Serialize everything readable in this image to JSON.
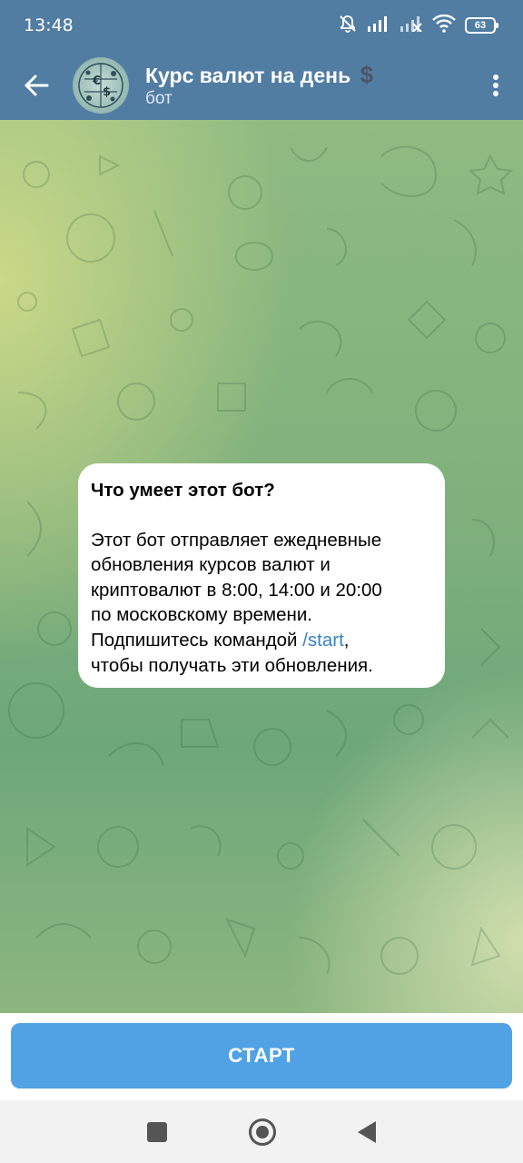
{
  "status_bar": {
    "time": "13:48",
    "battery": "63",
    "icons": [
      "mute-icon",
      "signal-icon",
      "signal-off-icon",
      "wifi-icon",
      "battery-icon"
    ]
  },
  "header": {
    "title": "Курс валют на день",
    "title_emoji": "$",
    "subtitle": "бот",
    "icons": [
      "back-arrow-icon",
      "more-vert-icon"
    ]
  },
  "message": {
    "title": "Что умеет этот бот?",
    "body_lines": [
      "Этот бот отправляет ежедневные",
      "обновления курсов валют и",
      "криптовалют в 8:00, 14:00 и 20:00",
      "по московскому времени.",
      "Подпишитесь командой ",
      "/start",
      ",",
      "чтобы получать эти обновления."
    ]
  },
  "start_button": {
    "label": "СТАРТ"
  },
  "colors": {
    "header": "#527da3",
    "start_button": "#50a2e5",
    "link": "#3a82c4",
    "dollar": "#4a5568"
  }
}
